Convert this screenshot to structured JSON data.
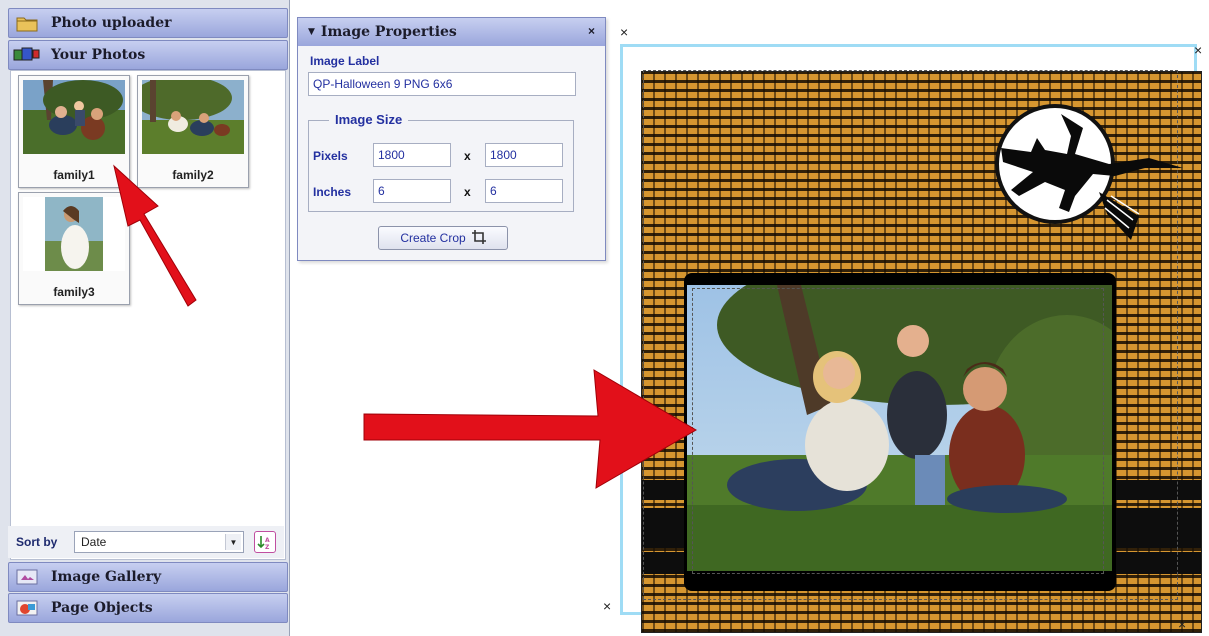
{
  "sidebar": {
    "uploader_title": "Photo uploader",
    "photos_title": "Your Photos",
    "gallery_title": "Image Gallery",
    "objects_title": "Page Objects",
    "photos": [
      {
        "name": "family1"
      },
      {
        "name": "family2"
      },
      {
        "name": "family3"
      }
    ],
    "sort": {
      "label": "Sort by",
      "value": "Date"
    }
  },
  "properties": {
    "title": "Image Properties",
    "close": "×",
    "image_label_heading": "Image Label",
    "image_label_value": "QP-Halloween 9 PNG 6x6",
    "size_legend": "Image Size",
    "pixels_label": "Pixels",
    "pixels_w": "1800",
    "pixels_h": "1800",
    "inches_label": "Inches",
    "inches_w": "6",
    "inches_h": "6",
    "by": "x",
    "crop_button": "Create Crop"
  },
  "canvas": {
    "close_marks": [
      "×",
      "×",
      "×",
      "×"
    ]
  },
  "colors": {
    "header_gradient_top": "#c7cff0",
    "header_gradient_bottom": "#9aa6dc",
    "label_blue": "#2330a0",
    "arrow_red": "#e2101a",
    "card_orange": "#d69630",
    "guide_blue": "#9fdcf5"
  },
  "icons": {
    "uploader": "folder-icon",
    "photos": "photos-icon",
    "gallery": "gallery-icon",
    "objects": "page-objects-icon",
    "close": "close-icon",
    "crop": "crop-icon",
    "sort": "sort-az-icon"
  }
}
